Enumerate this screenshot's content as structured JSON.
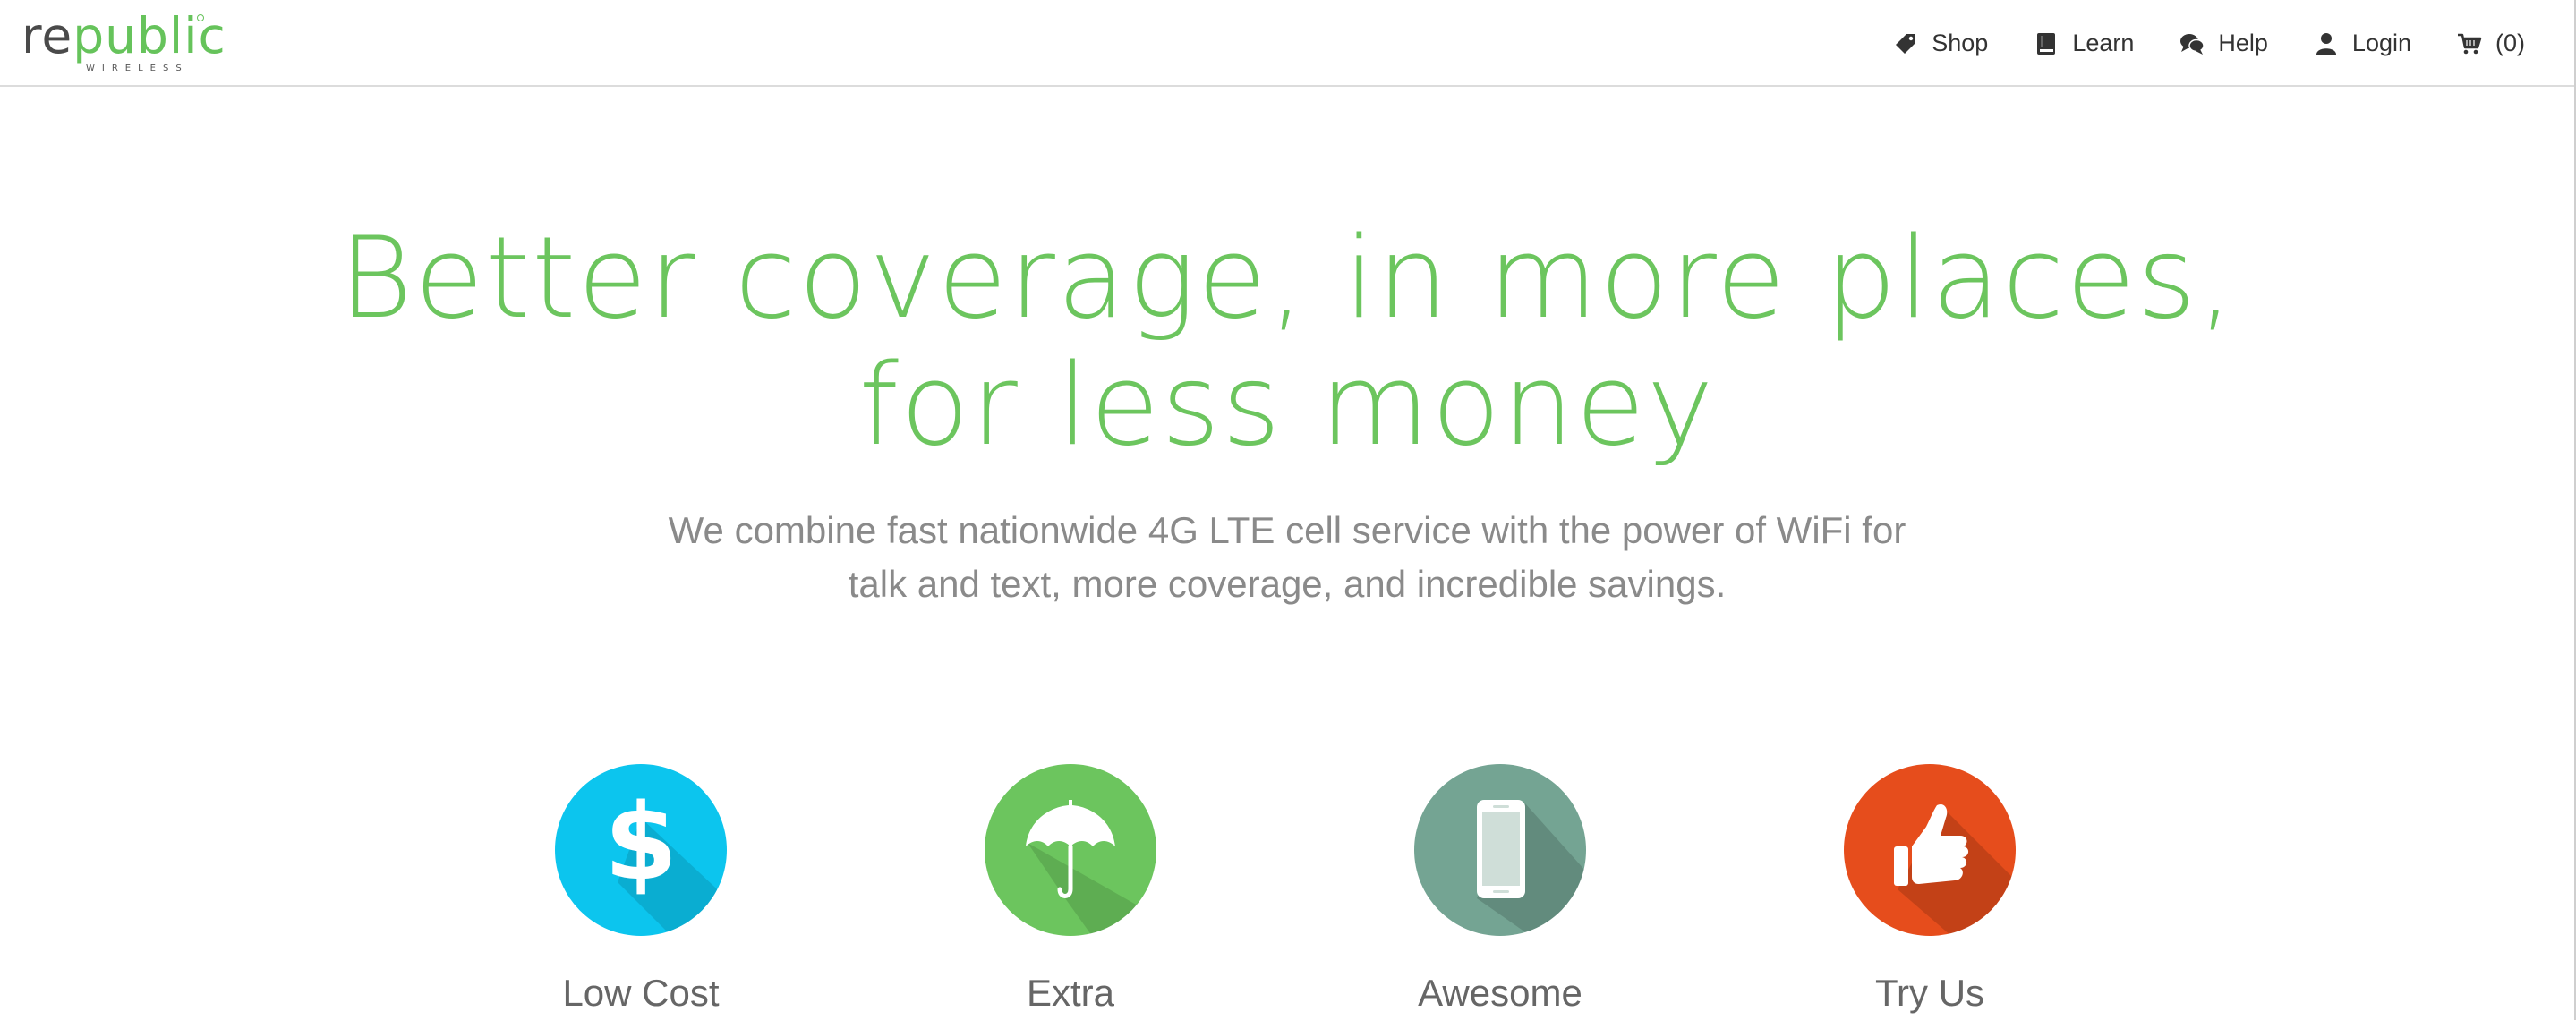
{
  "header": {
    "logo": {
      "word_dark": "re",
      "word_green": "public",
      "subtitle": "WIRELESS"
    },
    "nav": [
      {
        "label": "Shop",
        "icon": "tag-icon"
      },
      {
        "label": "Learn",
        "icon": "book-icon"
      },
      {
        "label": "Help",
        "icon": "chat-bubbles-icon"
      },
      {
        "label": "Login",
        "icon": "user-icon"
      },
      {
        "label": "(0)",
        "icon": "cart-icon"
      }
    ]
  },
  "hero": {
    "title_line1": "Better coverage, in more places,",
    "title_line2": "for less money",
    "subtitle_line1": "We combine fast nationwide 4G LTE cell service with the power of WiFi for",
    "subtitle_line2": "talk and text, more coverage, and incredible savings."
  },
  "features": [
    {
      "label": "Low Cost",
      "icon": "dollar-icon",
      "color": "#0cc5ee"
    },
    {
      "label": "Extra",
      "icon": "umbrella-icon",
      "color": "#6cc55e"
    },
    {
      "label": "Awesome",
      "icon": "phone-icon",
      "color": "#74a493"
    },
    {
      "label": "Try Us",
      "icon": "thumbs-up-icon",
      "color": "#e64d1c"
    }
  ],
  "colors": {
    "brand_green": "#6cc55e",
    "text_gray": "#8a8a8a",
    "nav_text": "#333333"
  }
}
